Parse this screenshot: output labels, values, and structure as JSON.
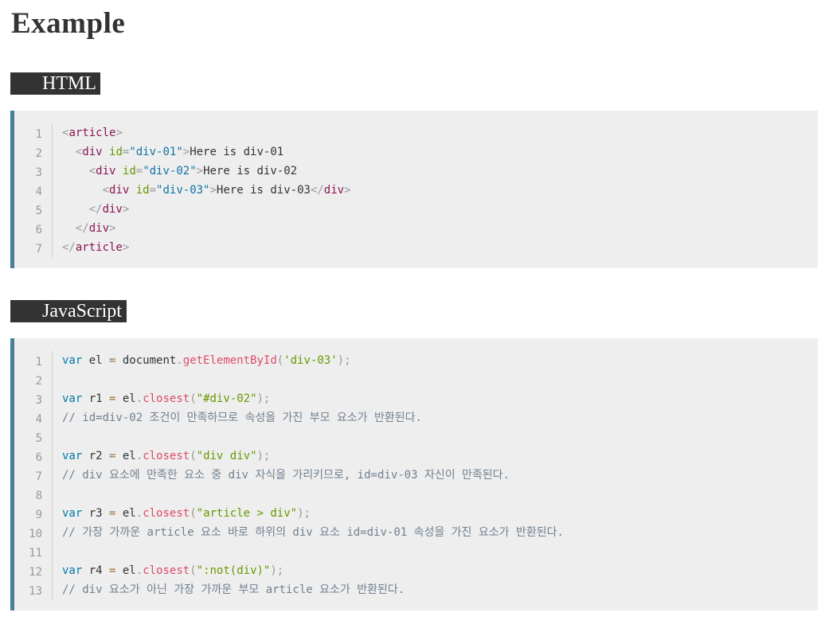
{
  "page": {
    "title": "Example"
  },
  "sections": {
    "html": {
      "label": "HTML",
      "lines": [
        {
          "n": "1",
          "tokens": [
            [
              "punc",
              "<"
            ],
            [
              "tagname",
              "article"
            ],
            [
              "punc",
              ">"
            ]
          ]
        },
        {
          "n": "2",
          "tokens": [
            [
              "plain",
              "  "
            ],
            [
              "punc",
              "<"
            ],
            [
              "tagname",
              "div"
            ],
            [
              "plain",
              " "
            ],
            [
              "attr",
              "id"
            ],
            [
              "punc",
              "="
            ],
            [
              "val",
              "\"div-01\""
            ],
            [
              "punc",
              ">"
            ],
            [
              "plain",
              "Here is div-01"
            ]
          ]
        },
        {
          "n": "3",
          "tokens": [
            [
              "plain",
              "    "
            ],
            [
              "punc",
              "<"
            ],
            [
              "tagname",
              "div"
            ],
            [
              "plain",
              " "
            ],
            [
              "attr",
              "id"
            ],
            [
              "punc",
              "="
            ],
            [
              "val",
              "\"div-02\""
            ],
            [
              "punc",
              ">"
            ],
            [
              "plain",
              "Here is div-02"
            ]
          ]
        },
        {
          "n": "4",
          "tokens": [
            [
              "plain",
              "      "
            ],
            [
              "punc",
              "<"
            ],
            [
              "tagname",
              "div"
            ],
            [
              "plain",
              " "
            ],
            [
              "attr",
              "id"
            ],
            [
              "punc",
              "="
            ],
            [
              "val",
              "\"div-03\""
            ],
            [
              "punc",
              ">"
            ],
            [
              "plain",
              "Here is div-03"
            ],
            [
              "punc",
              "</"
            ],
            [
              "tagname",
              "div"
            ],
            [
              "punc",
              ">"
            ]
          ]
        },
        {
          "n": "5",
          "tokens": [
            [
              "plain",
              "    "
            ],
            [
              "punc",
              "</"
            ],
            [
              "tagname",
              "div"
            ],
            [
              "punc",
              ">"
            ]
          ]
        },
        {
          "n": "6",
          "tokens": [
            [
              "plain",
              "  "
            ],
            [
              "punc",
              "</"
            ],
            [
              "tagname",
              "div"
            ],
            [
              "punc",
              ">"
            ]
          ]
        },
        {
          "n": "7",
          "tokens": [
            [
              "punc",
              "</"
            ],
            [
              "tagname",
              "article"
            ],
            [
              "punc",
              ">"
            ]
          ]
        }
      ]
    },
    "js": {
      "label": "JavaScript",
      "lines": [
        {
          "n": "1",
          "tokens": [
            [
              "kw",
              "var"
            ],
            [
              "plain",
              " el "
            ],
            [
              "op",
              "="
            ],
            [
              "plain",
              " document"
            ],
            [
              "punc",
              "."
            ],
            [
              "fn",
              "getElementById"
            ],
            [
              "punc",
              "("
            ],
            [
              "str",
              "'div-03'"
            ],
            [
              "punc",
              ");"
            ]
          ]
        },
        {
          "n": "2",
          "tokens": []
        },
        {
          "n": "3",
          "tokens": [
            [
              "kw",
              "var"
            ],
            [
              "plain",
              " r1 "
            ],
            [
              "op",
              "="
            ],
            [
              "plain",
              " el"
            ],
            [
              "punc",
              "."
            ],
            [
              "fn",
              "closest"
            ],
            [
              "punc",
              "("
            ],
            [
              "str",
              "\"#div-02\""
            ],
            [
              "punc",
              ");"
            ]
          ]
        },
        {
          "n": "4",
          "tokens": [
            [
              "comment",
              "// id=div-02 조건이 만족하므로 속성을 가진 부모 요소가 반환된다."
            ]
          ]
        },
        {
          "n": "5",
          "tokens": []
        },
        {
          "n": "6",
          "tokens": [
            [
              "kw",
              "var"
            ],
            [
              "plain",
              " r2 "
            ],
            [
              "op",
              "="
            ],
            [
              "plain",
              " el"
            ],
            [
              "punc",
              "."
            ],
            [
              "fn",
              "closest"
            ],
            [
              "punc",
              "("
            ],
            [
              "str",
              "\"div div\""
            ],
            [
              "punc",
              ");"
            ]
          ]
        },
        {
          "n": "7",
          "tokens": [
            [
              "comment",
              "// div 요소에 만족한 요소 중 div 자식을 가리키므로, id=div-03 자신이 만족된다."
            ]
          ]
        },
        {
          "n": "8",
          "tokens": []
        },
        {
          "n": "9",
          "tokens": [
            [
              "kw",
              "var"
            ],
            [
              "plain",
              " r3 "
            ],
            [
              "op",
              "="
            ],
            [
              "plain",
              " el"
            ],
            [
              "punc",
              "."
            ],
            [
              "fn",
              "closest"
            ],
            [
              "punc",
              "("
            ],
            [
              "str",
              "\"article > div\""
            ],
            [
              "punc",
              ");"
            ]
          ]
        },
        {
          "n": "10",
          "tokens": [
            [
              "comment",
              "// 가장 가까운 article 요소 바로 하위의 div 요소 id=div-01 속성을 가진 요소가 반환된다."
            ]
          ]
        },
        {
          "n": "11",
          "tokens": []
        },
        {
          "n": "12",
          "tokens": [
            [
              "kw",
              "var"
            ],
            [
              "plain",
              " r4 "
            ],
            [
              "op",
              "="
            ],
            [
              "plain",
              " el"
            ],
            [
              "punc",
              "."
            ],
            [
              "fn",
              "closest"
            ],
            [
              "punc",
              "("
            ],
            [
              "str",
              "\":not(div)\""
            ],
            [
              "punc",
              ");"
            ]
          ]
        },
        {
          "n": "13",
          "tokens": [
            [
              "comment",
              "// div 요소가 아닌 가장 가까운 부모 article 요소가 반환된다."
            ]
          ]
        }
      ]
    }
  },
  "colors": {
    "code_background": "#eeeeee",
    "code_left_border": "#4a7e9c",
    "label_background": "#333333",
    "keyword": "#0077aa",
    "function": "#dd4a68",
    "string": "#669900",
    "attr_value": "#0f74a3",
    "tag_name": "#8a1456",
    "comment": "#708090"
  }
}
